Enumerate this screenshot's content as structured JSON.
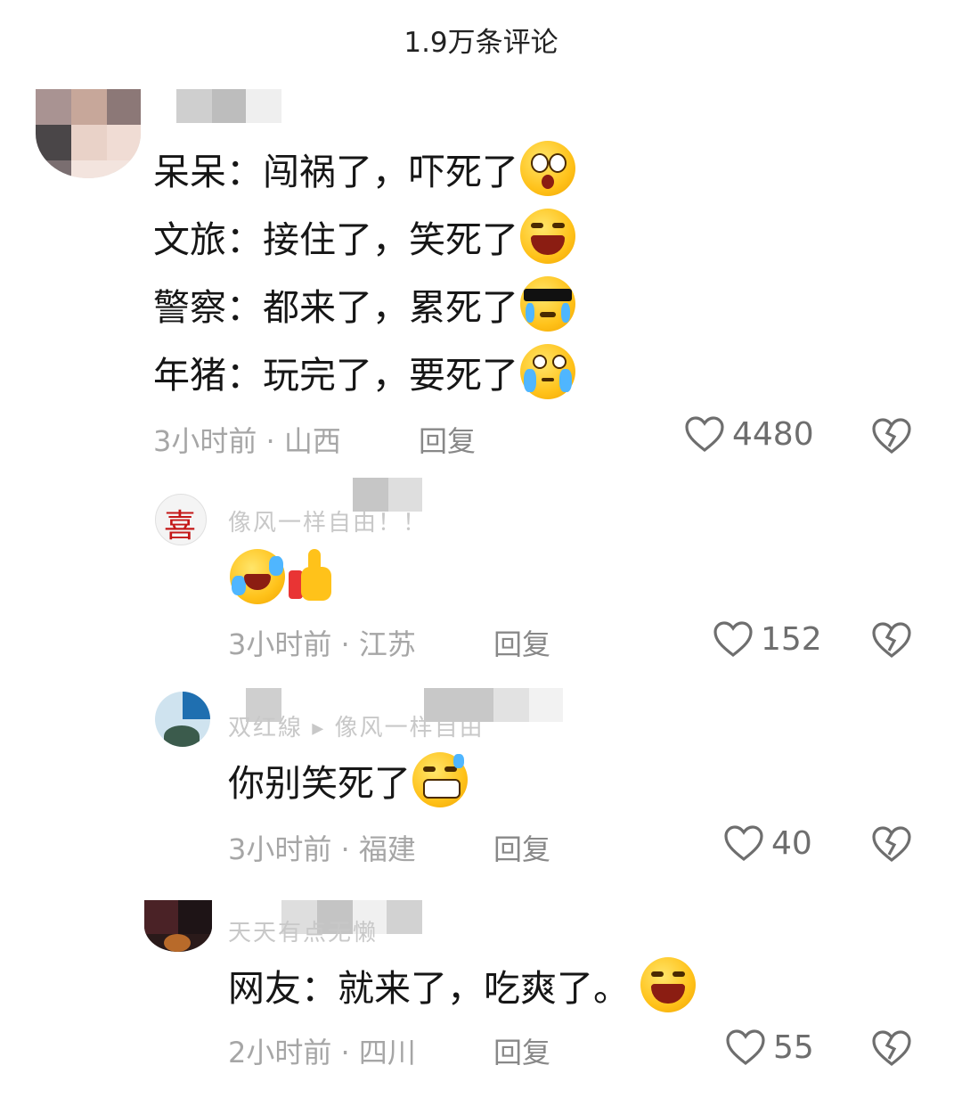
{
  "header": {
    "title": "1.9万条评论"
  },
  "comments": [
    {
      "lines": [
        {
          "speaker": "呆呆：",
          "text": "闯祸了，吓死了",
          "emoji": "shocked-emoji"
        },
        {
          "speaker": "文旅：",
          "text": "接住了，笑死了",
          "emoji": "laughing-emoji"
        },
        {
          "speaker": "警察：",
          "text": "都来了，累死了",
          "emoji": "sunglasses-crying-emoji"
        },
        {
          "speaker": "年猪：",
          "text": "玩完了，要死了",
          "emoji": "heartbroken-crying-emoji"
        }
      ],
      "time": "3小时前",
      "location": "山西",
      "reply_label": "回复",
      "likes": "4480"
    },
    {
      "username": "像风一样自由！！",
      "avatar_char": "喜",
      "text": "",
      "time": "3小时前",
      "location": "江苏",
      "reply_label": "回复",
      "likes": "152"
    },
    {
      "username": "双红線 ▸ 像风一样自由",
      "text": "你别笑死了",
      "time": "3小时前",
      "location": "福建",
      "reply_label": "回复",
      "likes": "40"
    },
    {
      "username": "天天有点无懒",
      "text": "网友：就来了，吃爽了。",
      "time": "2小时前",
      "location": "四川",
      "reply_label": "回复",
      "likes": "55"
    }
  ],
  "colors": {
    "heart_stroke": "#6e6e6e",
    "meta_text": "#a6a6a6",
    "emoji_yellow": "#ffc21a"
  }
}
